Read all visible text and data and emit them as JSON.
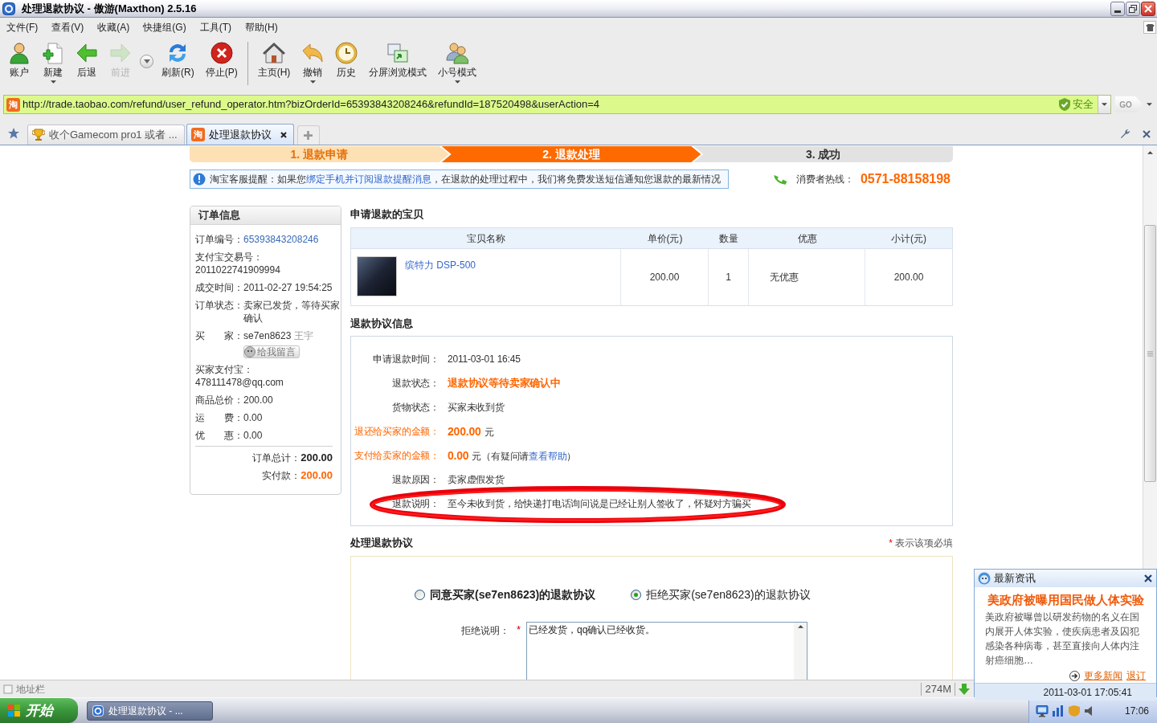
{
  "window": {
    "title": "处理退款协议 - 傲游(Maxthon) 2.5.16"
  },
  "menu": [
    "文件(F)",
    "查看(V)",
    "收藏(A)",
    "快捷组(G)",
    "工具(T)",
    "帮助(H)"
  ],
  "toolbar": [
    {
      "kind": "button",
      "label": "账户",
      "disabled": false,
      "dropdown": false
    },
    {
      "kind": "button",
      "label": "新建",
      "disabled": false,
      "dropdown": true
    },
    {
      "kind": "button",
      "label": "后退",
      "disabled": false,
      "dropdown": false
    },
    {
      "kind": "button",
      "label": "前进",
      "disabled": true,
      "dropdown": false
    },
    {
      "kind": "history"
    },
    {
      "kind": "button",
      "label": "刷新(R)",
      "disabled": false,
      "dropdown": false
    },
    {
      "kind": "button",
      "label": "停止(P)",
      "disabled": false,
      "dropdown": false
    },
    {
      "kind": "separator"
    },
    {
      "kind": "button",
      "label": "主页(H)",
      "disabled": false,
      "dropdown": false
    },
    {
      "kind": "button",
      "label": "撤销",
      "disabled": false,
      "dropdown": true
    },
    {
      "kind": "button",
      "label": "历史",
      "disabled": false,
      "dropdown": false
    },
    {
      "kind": "button",
      "label": "分屏浏览模式",
      "disabled": false,
      "dropdown": false
    },
    {
      "kind": "button",
      "label": "小号模式",
      "disabled": false,
      "dropdown": true
    }
  ],
  "address_bar": {
    "favicon": "淘",
    "url": "http://trade.taobao.com/refund/user_refund_operator.htm?bizOrderId=65393843208246&refundId=187520498&userAction=4",
    "security": "安全",
    "go_button": "GO"
  },
  "tabs": [
    {
      "label": "收个Gamecom pro1 或者 ...",
      "selected": false
    },
    {
      "favicon": "淘",
      "label": "处理退款协议",
      "selected": true
    }
  ],
  "steps": [
    {
      "label": "1. 退款申请",
      "completed": true,
      "selected": false
    },
    {
      "label": "2. 退款处理",
      "completed": false,
      "selected": true
    },
    {
      "label": "3. 成功",
      "completed": false,
      "selected": false
    }
  ],
  "notice": {
    "prefix": "淘宝客服提醒：如果您",
    "link": "绑定手机并订阅退款提醒消息",
    "suffix": "，在退款的处理过程中，我们将免费发送短信通知您退款的最新情况"
  },
  "hotline": {
    "label": "消费者热线：",
    "number": "0571-88158198"
  },
  "order_info": {
    "title": "订单信息",
    "rows": [
      {
        "kind": "link",
        "label": "订单编号：",
        "value": "65393843208246"
      },
      {
        "kind": "stacked",
        "label": "支付宝交易号：",
        "value": "2011022741909994"
      },
      {
        "kind": "text",
        "label": "成交时间：",
        "value": "2011-02-27 19:54:25"
      },
      {
        "kind": "text",
        "label": "订单状态：",
        "value": "卖家已发货，等待买家确认"
      },
      {
        "kind": "buyer",
        "label": "买　　家：",
        "value": "se7en8623",
        "name": "王宇",
        "button": "给我留言"
      },
      {
        "kind": "stacked",
        "label": "买家支付宝：",
        "value": "478111478@qq.com"
      },
      {
        "kind": "text",
        "label": "商品总价：",
        "value": "200.00"
      },
      {
        "kind": "text",
        "label": "运　　费：",
        "value": "0.00"
      },
      {
        "kind": "text",
        "label": "优　　惠：",
        "value": "0.00"
      }
    ],
    "totals": [
      {
        "label": "订单总计：",
        "value": "200.00",
        "highlight": false
      },
      {
        "label": "实付款：",
        "value": "200.00",
        "highlight": true
      }
    ]
  },
  "refund_items": {
    "title": "申请退款的宝贝",
    "columns": [
      "宝贝名称",
      "单价(元)",
      "数量",
      "优惠",
      "小计(元)"
    ],
    "rows": [
      {
        "name": "缤特力 DSP-500",
        "price": "200.00",
        "quantity": "1",
        "discount": "无优惠",
        "subtotal": "200.00"
      }
    ]
  },
  "agreement": {
    "title": "退款协议信息",
    "rows": [
      {
        "kind": "text",
        "label": "申请退款时间：",
        "value": "2011-03-01 16:45"
      },
      {
        "kind": "status",
        "label": "退款状态：",
        "value": "退款协议等待卖家确认中"
      },
      {
        "kind": "text",
        "label": "货物状态：",
        "value": "买家未收到货"
      },
      {
        "kind": "amount",
        "label": "退还给买家的金额：",
        "amount": "200.00",
        "unit": "元"
      },
      {
        "kind": "amount-help",
        "label": "支付给卖家的金额：",
        "amount": "0.00",
        "unit": "元（有疑问请",
        "link": "查看帮助",
        "suffix": "）"
      },
      {
        "kind": "text",
        "label": "退款原因：",
        "value": "卖家虚假发货"
      },
      {
        "kind": "text",
        "label": "退款说明：",
        "value": "至今未收到货，给快递打电话询问说是已经让别人签收了，怀疑对方骗买"
      }
    ]
  },
  "handling": {
    "title": "处理退款协议",
    "required_note": {
      "mark": "*",
      "text": "表示该项必填"
    },
    "options": [
      {
        "label": "同意买家(se7en8623)的退款协议",
        "selected": false,
        "bold": true
      },
      {
        "label": "拒绝买家(se7en8623)的退款协议",
        "selected": true,
        "bold": false
      }
    ],
    "reason": {
      "label": "拒绝说明：",
      "mark": "*",
      "value": "已经发货，qq确认已经收货。"
    }
  },
  "status_bar": {
    "label": "地址栏",
    "memory": "274M"
  },
  "news_popup": {
    "title": "最新资讯",
    "headline": "美政府被曝用国民做人体实验",
    "body": "美政府被曝曾以研发药物的名义在国内展开人体实验，使疾病患者及囚犯感染各种病毒，甚至直接向人体内注射癌细胞…",
    "links": [
      "更多新闻",
      "退订"
    ],
    "time": "2011-03-01 17:05:41"
  },
  "taskbar": {
    "start": "开始",
    "tasks": [
      "处理退款协议 - ..."
    ],
    "clock": "17:06"
  }
}
